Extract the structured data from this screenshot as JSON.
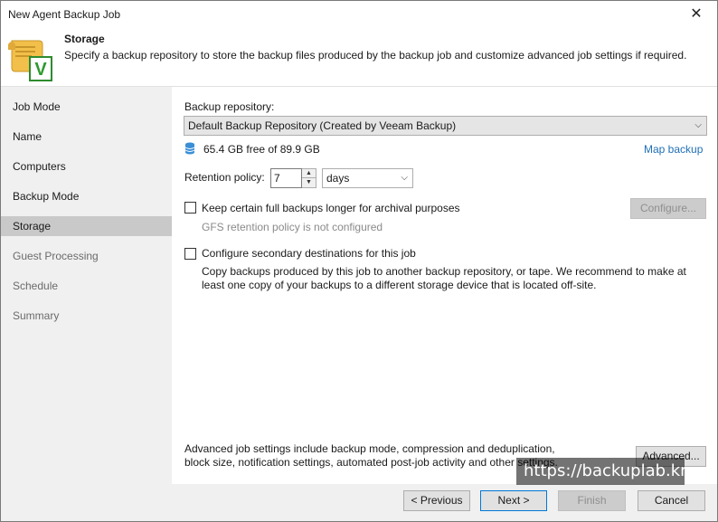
{
  "window": {
    "title": "New Agent Backup Job",
    "close_glyph": "✕"
  },
  "header": {
    "title": "Storage",
    "description": "Specify a backup repository to store the backup files produced by the backup job and customize advanced job settings if required.",
    "icon": "scroll-checkmark-icon",
    "icon_letter": "V"
  },
  "sidebar": {
    "items": [
      {
        "label": "Job Mode"
      },
      {
        "label": "Name"
      },
      {
        "label": "Computers"
      },
      {
        "label": "Backup Mode"
      },
      {
        "label": "Storage"
      },
      {
        "label": "Guest Processing"
      },
      {
        "label": "Schedule"
      },
      {
        "label": "Summary"
      }
    ]
  },
  "storage": {
    "repository_label": "Backup repository:",
    "repository_value": "Default Backup Repository (Created by Veeam Backup)",
    "free_space": "65.4 GB free of 89.9 GB",
    "map_backup_link": "Map backup",
    "retention_label": "Retention policy:",
    "retention_value": "7",
    "retention_unit": "days",
    "archival_label": "Keep certain full backups longer for archival purposes",
    "archival_checked": false,
    "gfs_status": "GFS retention policy is not configured",
    "configure_button": "Configure...",
    "secondary_label": "Configure secondary destinations for this job",
    "secondary_checked": false,
    "secondary_description": "Copy backups produced by this job to another backup repository, or tape. We recommend to make at least one copy of your backups to a different storage device that is located off-site.",
    "advanced_description": "Advanced job settings include backup mode, compression and deduplication, block size, notification settings, automated post-job activity and other settings.",
    "advanced_button": "Advanced..."
  },
  "buttons": {
    "previous": "< Previous",
    "next": "Next >",
    "finish": "Finish",
    "cancel": "Cancel"
  },
  "watermark": "https://backuplab.kr",
  "colors": {
    "link": "#1f6fb5",
    "sidebar_bg": "#f0f0f0",
    "sidebar_active": "#c9c9c9",
    "focus_border": "#0078d7"
  }
}
